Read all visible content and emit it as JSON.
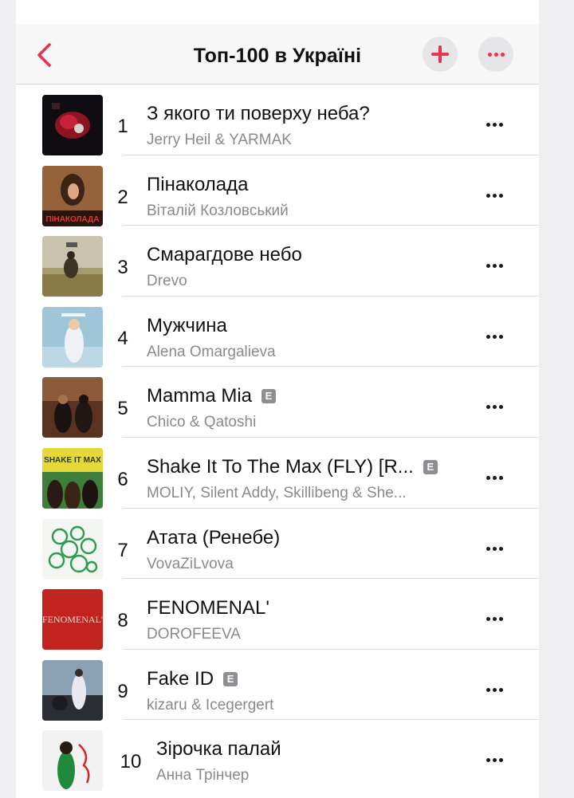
{
  "header": {
    "title": "Топ-100 в Україні",
    "back_icon": "chevron-left-icon",
    "add_icon": "plus-icon",
    "more_icon": "ellipsis-icon",
    "accent_color": "#e8344e"
  },
  "tracks": [
    {
      "rank": "1",
      "title": "З якого ти поверху неба?",
      "artist": "Jerry Heil & YARMAK",
      "explicit": false
    },
    {
      "rank": "2",
      "title": "Пінаколада",
      "artist": "Віталій Козловський",
      "explicit": false
    },
    {
      "rank": "3",
      "title": "Смарагдове небо",
      "artist": "Drevo",
      "explicit": false
    },
    {
      "rank": "4",
      "title": "Мужчина",
      "artist": "Alena Omargalieva",
      "explicit": false
    },
    {
      "rank": "5",
      "title": "Mamma Mia",
      "artist": "Chico & Qatoshi",
      "explicit": true
    },
    {
      "rank": "6",
      "title": "Shake It To The Max (FLY) [R...",
      "artist": "MOLIY, Silent Addy, Skillibeng & She...",
      "explicit": true
    },
    {
      "rank": "7",
      "title": "Атата (Ренебе)",
      "artist": "VovaZiLvova",
      "explicit": false
    },
    {
      "rank": "8",
      "title": "FENOMENAL'",
      "artist": "DOROFEEVA",
      "explicit": false
    },
    {
      "rank": "9",
      "title": "Fake ID",
      "artist": "kizaru & Icegergert",
      "explicit": true
    },
    {
      "rank": "10",
      "title": "Зірочка палай",
      "artist": "Анна Трінчер",
      "explicit": false
    }
  ],
  "explicit_label": "E",
  "covers": {
    "2": "ПІНАКОЛАДА",
    "6": "SHAKE IT MAX",
    "8": "FENOMENAL'"
  }
}
